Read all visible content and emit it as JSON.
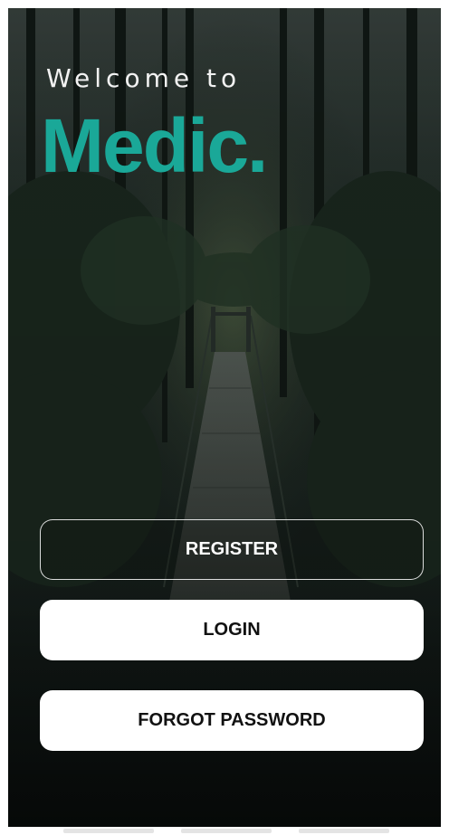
{
  "welcome": {
    "line1": "Welcome to",
    "brand": "Medic."
  },
  "buttons": {
    "register": "REGISTER",
    "login": "LOGIN",
    "forgot_password": "FORGOT PASSWORD"
  },
  "colors": {
    "brand_accent": "#1aa898",
    "button_fill": "#ffffff",
    "overlay": "#141c19"
  },
  "background": {
    "icon": "forest-suspension-bridge-photo"
  }
}
